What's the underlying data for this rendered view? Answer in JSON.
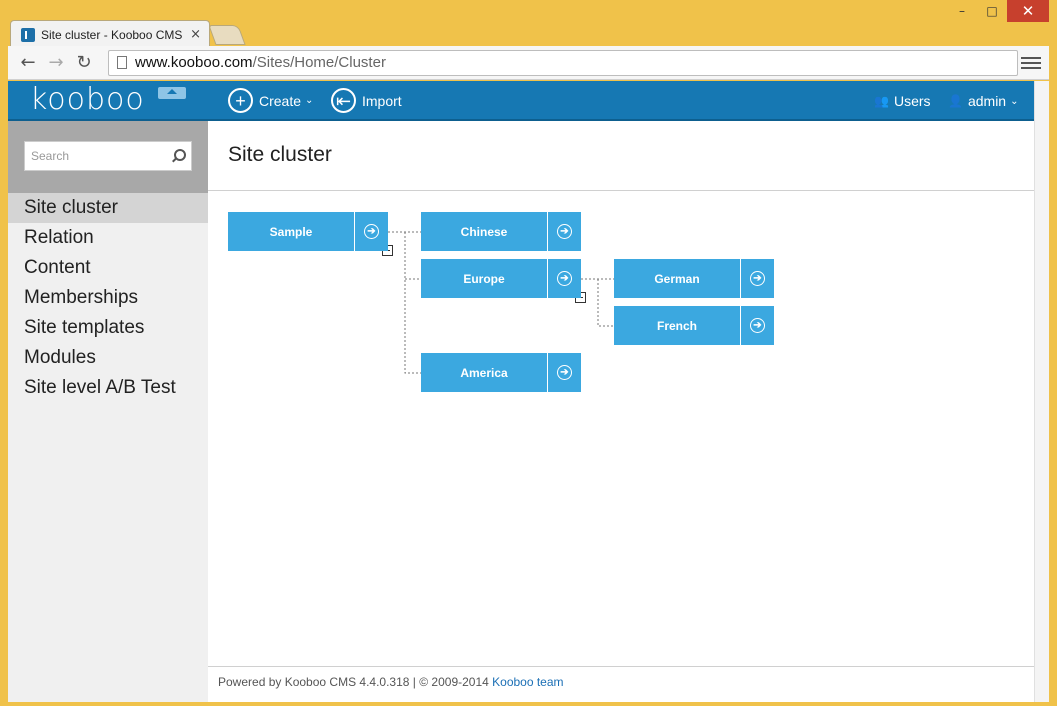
{
  "browser": {
    "tab_title": "Site cluster - Kooboo CMS",
    "tab_close": "×",
    "url_host": "www.kooboo.com",
    "url_path": "/Sites/Home/Cluster",
    "window_minimize": "–",
    "window_maximize": "□",
    "window_close": "✕",
    "back": "←",
    "forward": "→",
    "reload": "↻"
  },
  "topbar": {
    "logo": "kooboo",
    "create_label": "Create",
    "create_icon": "+",
    "import_label": "Import",
    "import_icon": "⇤",
    "users_label": "Users",
    "admin_label": "admin",
    "chevron": "⌄",
    "users_icon": "👥",
    "admin_icon": "👤"
  },
  "sidebar": {
    "search_placeholder": "Search",
    "items": [
      {
        "label": "Site cluster",
        "active": true
      },
      {
        "label": "Relation"
      },
      {
        "label": "Content"
      },
      {
        "label": "Memberships"
      },
      {
        "label": "Site templates"
      },
      {
        "label": "Modules"
      },
      {
        "label": "Site level A/B Test"
      }
    ]
  },
  "main": {
    "title": "Site cluster",
    "nodes": {
      "sample": "Sample",
      "chinese": "Chinese",
      "europe": "Europe",
      "german": "German",
      "french": "French",
      "america": "America"
    },
    "go_icon": "➔"
  },
  "footer": {
    "text": "Powered by Kooboo CMS 4.4.0.318 | © 2009-2014 ",
    "link": "Kooboo team"
  },
  "colors": {
    "brand": "#1678b3",
    "node": "#3ba8e0",
    "window_frame": "#f0c24a"
  }
}
